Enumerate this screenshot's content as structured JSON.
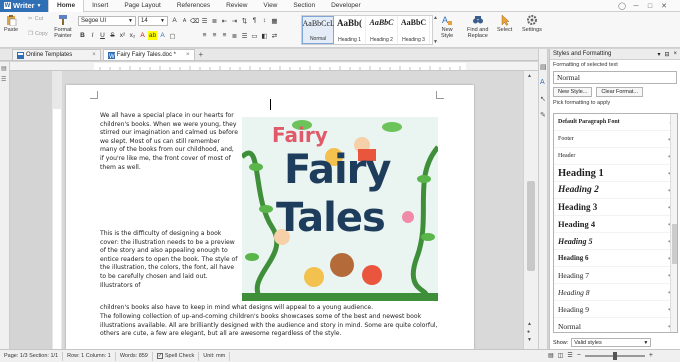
{
  "menubar": {
    "app_name": "Writer",
    "items": [
      "Home",
      "Insert",
      "Page Layout",
      "References",
      "Review",
      "View",
      "Section",
      "Developer"
    ],
    "active": "Home"
  },
  "ribbon": {
    "paste_label": "Paste",
    "cut_label": "Cut",
    "copy_label": "Copy",
    "format_painter_label": "Format\nPainter",
    "font_name": "Segoe UI",
    "font_size": "14",
    "style_gallery": [
      {
        "sample": "AaBbCcL",
        "name": "Normal",
        "selected": true
      },
      {
        "sample": "AaBb(",
        "name": "Heading 1",
        "selected": false
      },
      {
        "sample": "AaBbC",
        "name": "Heading 2",
        "selected": false
      },
      {
        "sample": "AaBbC",
        "name": "Heading 3",
        "selected": false
      }
    ],
    "new_style_label": "New\nStyle",
    "find_replace_label": "Find and\nReplace",
    "select_label": "Select",
    "settings_label": "Settings"
  },
  "tabs": {
    "items": [
      {
        "label": "Online Templates",
        "active": false
      },
      {
        "label": "Fairy Fairy Tales.doc *",
        "active": true
      }
    ]
  },
  "document": {
    "para1": "We all have a special place in our hearts for children's books. When we were young, they stirred our imagination and calmed us before we slept. Most of us can still remember many of the books from our childhood, and, if you're like me, the front cover of most of them as well.",
    "para2": "This is the difficulty of designing a book cover: the illustration needs to be a preview of the story and also appealing enough to entice readers to open the book. The style of the illustration, the colors, the font, all have to be carefully chosen and laid out. Illustrators of",
    "para3": "children's books also have to keep in mind what designs will appeal to a young audience.",
    "para4": "The following collection of up-and-coming children's books showcases some of the best and newest book illustrations available. All are brilliantly designed with the audience and story in mind. Some are quite colorful, others are cute, a few are elegant, but all are awesome regardless of the style.",
    "cover_title_1": "Fairy",
    "cover_title_2": "Fairy",
    "cover_title_3": "Tales"
  },
  "panel": {
    "title": "Styles and Formatting",
    "formatting_label": "Formatting of selected text",
    "current_style": "Normal",
    "new_style_btn": "New Style...",
    "clear_format_btn": "Clear Format...",
    "pick_label": "Pick formatting to apply",
    "styles": [
      {
        "name": "Default Paragraph Font",
        "size": 6,
        "weight": "bold",
        "italic": false
      },
      {
        "name": "Footer",
        "size": 6,
        "weight": "normal",
        "italic": false
      },
      {
        "name": "Header",
        "size": 6,
        "weight": "normal",
        "italic": false
      },
      {
        "name": "Heading 1",
        "size": 10.5,
        "weight": "bold",
        "italic": false
      },
      {
        "name": "Heading 2",
        "size": 9.5,
        "weight": "bold",
        "italic": true
      },
      {
        "name": "Heading 3",
        "size": 9,
        "weight": "bold",
        "italic": false
      },
      {
        "name": "Heading 4",
        "size": 8.5,
        "weight": "bold",
        "italic": false
      },
      {
        "name": "Heading 5",
        "size": 8,
        "weight": "bold",
        "italic": true
      },
      {
        "name": "Heading 6",
        "size": 7,
        "weight": "bold",
        "italic": false
      },
      {
        "name": "Heading 7",
        "size": 7.5,
        "weight": "normal",
        "italic": false
      },
      {
        "name": "Heading 8",
        "size": 7.5,
        "weight": "normal",
        "italic": true
      },
      {
        "name": "Heading 9",
        "size": 7.5,
        "weight": "normal",
        "italic": false
      },
      {
        "name": "Normal",
        "size": 7.5,
        "weight": "normal",
        "italic": false
      }
    ],
    "show_label": "Show:",
    "show_value": "Valid styles"
  },
  "status": {
    "page": "Page: 1/3 Section: 1/1",
    "row_col": "Row: 1 Column: 1",
    "words": "Words: 859",
    "spell": "Spell Check",
    "unit": "Unit: mm"
  },
  "colors": {
    "accent": "#2f6fb6",
    "cover_title": "#1e3d5c",
    "leaf": "#3f8f3a"
  }
}
